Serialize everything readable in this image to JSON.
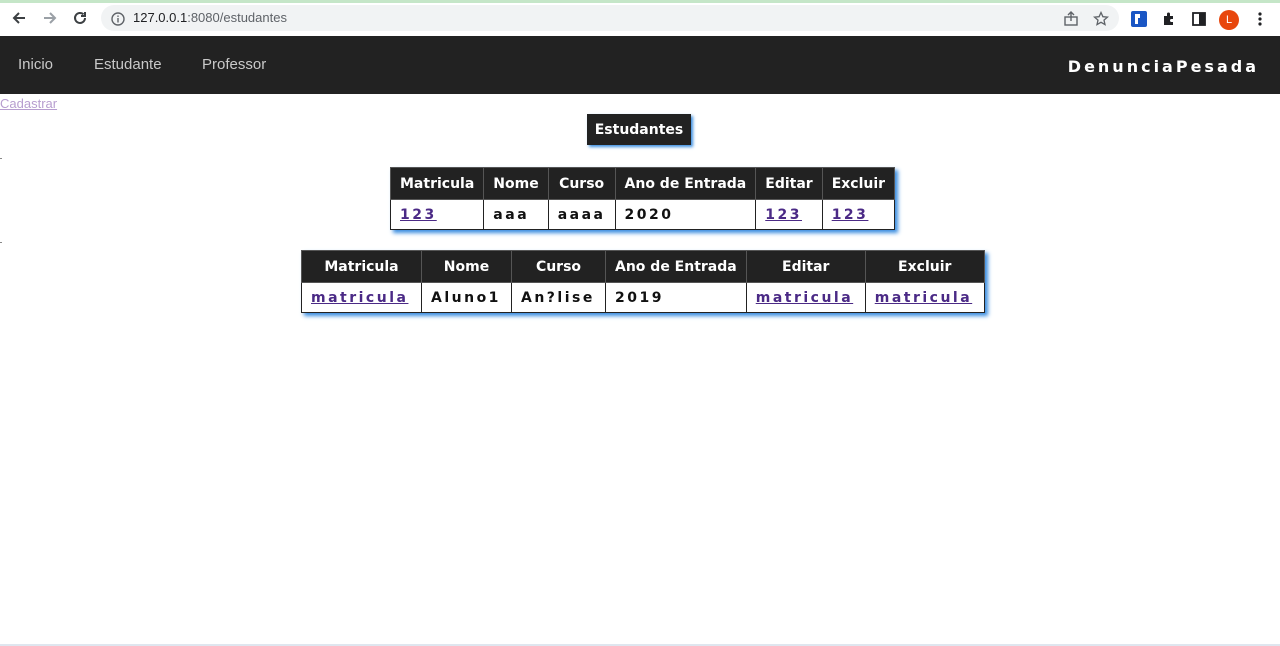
{
  "browser": {
    "url_host": "127.0.0.1",
    "url_rest": ":8080/estudantes",
    "profile_initial": "L"
  },
  "navbar": {
    "links": [
      "Inicio",
      "Estudante",
      "Professor"
    ],
    "brand": "DenunciaPesada"
  },
  "page": {
    "cadastrar_link": "Cadastrar",
    "title": "Estudantes"
  },
  "tables": [
    {
      "headers": [
        "Matricula",
        "Nome",
        "Curso",
        "Ano de Entrada",
        "Editar",
        "Excluir"
      ],
      "rows": [
        [
          "123",
          "aaa",
          "aaaa",
          "2020",
          "123",
          "123"
        ]
      ]
    },
    {
      "headers": [
        "Matricula",
        "Nome",
        "Curso",
        "Ano de Entrada",
        "Editar",
        "Excluir"
      ],
      "rows": [
        [
          "matricula",
          "Aluno1",
          "An?lise",
          "2019",
          "matricula",
          "matricula"
        ]
      ]
    }
  ],
  "colors": {
    "navbar_bg": "#222222",
    "link_visited": "#4b2a86",
    "shadow_accent": "#3a8de0"
  }
}
